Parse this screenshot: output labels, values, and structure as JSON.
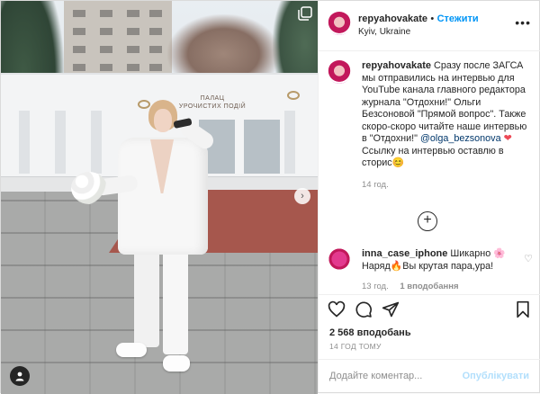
{
  "post": {
    "carousel_icon": "carousel-icon",
    "tag_icon": "user-tag-icon",
    "next_icon": "chevron-right-icon",
    "photo_sign": "ПАЛАЦ\nУРОЧИСТИХ ПОДІЙ"
  },
  "header": {
    "username": "repyahovakate",
    "dot": "•",
    "follow_label": "Стежити",
    "location": "Kyiv, Ukraine",
    "more_icon": "more-options-icon"
  },
  "caption": {
    "username": "repyahovakate",
    "text_1": "Сразу после ЗАГСА мы отправились на интервью для YouTube канала главного редактора журнала \"Отдохни!\" Ольги Безсоновой \"Прямой вопрос\". Также скоро-скоро читайте наше интервью в \"Отдохни!\"",
    "mention": "@olga_bezsonova",
    "emoji_heart": "❤",
    "text_2": "Ссылку на интервью оставлю в сторис",
    "emoji_smile": "😊",
    "time": "14 год."
  },
  "load_more_icon": "plus-circle-icon",
  "comment": {
    "username": "inna_case_iphone",
    "text_1": "Шикарно",
    "emoji_flower": "🌸",
    "text_2": "Наряд",
    "emoji_fire": "🔥",
    "text_3": "Вы крутая пара,ура!",
    "time": "13 год.",
    "likes": "1 вподобання",
    "like_icon": "heart-outline-icon"
  },
  "actions": {
    "like_icon": "heart-outline-icon",
    "comment_icon": "comment-icon",
    "share_icon": "share-icon",
    "save_icon": "bookmark-icon",
    "likes_count": "2 568 вподобань",
    "date": "14 ГОД ТОМУ"
  },
  "add_comment": {
    "placeholder": "Додайте коментар...",
    "publish_label": "Опублікувати"
  },
  "colors": {
    "accent": "#0095f6",
    "publish_disabled": "#b2dffc",
    "muted": "#8e8e8e",
    "heart": "#ed4956"
  }
}
